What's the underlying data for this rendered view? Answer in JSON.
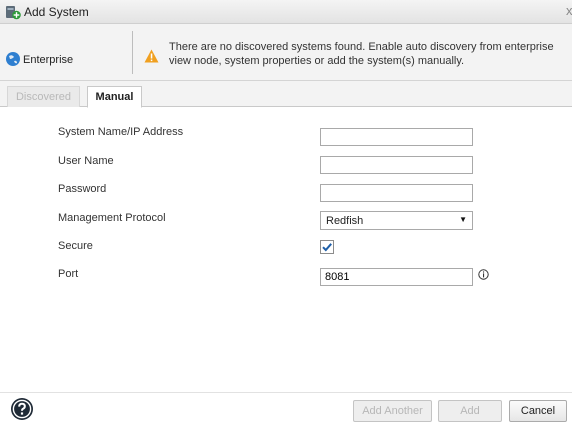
{
  "window": {
    "title": "Add System",
    "close_glyph": "x",
    "icon": "add-system-icon"
  },
  "header": {
    "nav_label": "Enterprise",
    "nav_icon": "globe-icon",
    "warning_icon": "warning-icon",
    "warning_text": "There are no discovered systems found. Enable auto discovery from enterprise view node, system properties or add the system(s) manually."
  },
  "tabs": [
    {
      "label": "Discovered",
      "state": "disabled"
    },
    {
      "label": "Manual",
      "state": "active"
    }
  ],
  "form": {
    "system_name_label": "System Name/IP Address",
    "system_name_value": "",
    "user_name_label": "User Name",
    "user_name_value": "",
    "password_label": "Password",
    "password_value": "",
    "protocol_label": "Management Protocol",
    "protocol_value": "Redfish",
    "protocol_arrow": "▼",
    "secure_label": "Secure",
    "secure_checked": true,
    "port_label": "Port",
    "port_value": "8081"
  },
  "footer": {
    "help_icon": "help-icon",
    "buttons": [
      {
        "label": "Add Another",
        "enabled": false
      },
      {
        "label": "Add",
        "enabled": false
      },
      {
        "label": "Cancel",
        "enabled": true
      }
    ]
  },
  "colors": {
    "accent_blue": "#1f74c8",
    "warning_orange": "#f0a020",
    "checkmark": "#1f5fa8"
  }
}
